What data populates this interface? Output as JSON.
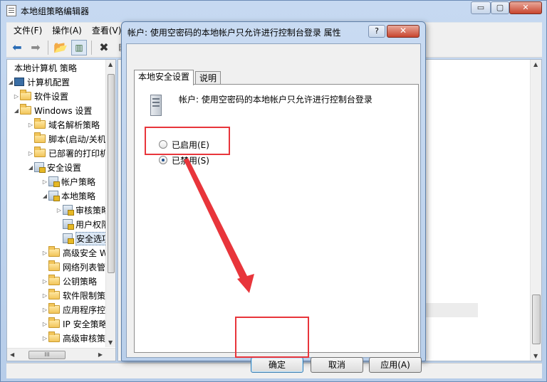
{
  "main_window": {
    "title": "本地组策略编辑器",
    "controls": {
      "minimize": "▭",
      "restore": "▢",
      "close": "✕"
    },
    "menu": [
      "文件(F)",
      "操作(A)",
      "查看(V)"
    ],
    "toolbar_icons": [
      "back-arrow-icon",
      "forward-arrow-icon",
      "up-folder-icon",
      "show-hide-tree-icon",
      "delete-icon",
      "properties-icon"
    ]
  },
  "tree": [
    {
      "label": "本地计算机 策略",
      "icon": "policy-icon",
      "arrow": ""
    },
    {
      "label": "计算机配置",
      "icon": "computer-icon",
      "arrow": "◢"
    },
    {
      "label": "软件设置",
      "icon": "folder-icon",
      "arrow": "▷"
    },
    {
      "label": "Windows 设置",
      "icon": "folder-icon",
      "arrow": "◢"
    },
    {
      "label": "域名解析策略",
      "icon": "folder-icon",
      "arrow": "▷"
    },
    {
      "label": "脚本(启动/关机",
      "icon": "script-icon",
      "arrow": ""
    },
    {
      "label": "已部署的打印机",
      "icon": "printer-icon",
      "arrow": "▷"
    },
    {
      "label": "安全设置",
      "icon": "security-icon",
      "arrow": "◢"
    },
    {
      "label": "帐户策略",
      "icon": "folder-lock-icon",
      "arrow": "▷"
    },
    {
      "label": "本地策略",
      "icon": "folder-lock-icon",
      "arrow": "◢"
    },
    {
      "label": "审核策略",
      "icon": "folder-lock-icon",
      "arrow": "▷"
    },
    {
      "label": "用户权限",
      "icon": "folder-lock-icon",
      "arrow": ""
    },
    {
      "label": "安全选项",
      "icon": "folder-lock-icon",
      "arrow": ""
    },
    {
      "label": "高级安全 W",
      "icon": "folder-icon",
      "arrow": "▷"
    },
    {
      "label": "网络列表管理",
      "icon": "folder-icon",
      "arrow": ""
    },
    {
      "label": "公钥策略",
      "icon": "folder-icon",
      "arrow": "▷"
    },
    {
      "label": "软件限制策略",
      "icon": "folder-icon",
      "arrow": "▷"
    },
    {
      "label": "应用程序控制",
      "icon": "folder-icon",
      "arrow": "▷"
    },
    {
      "label": "IP 安全策略",
      "icon": "ip-security-icon",
      "arrow": "▷"
    },
    {
      "label": "高级审核策略",
      "icon": "folder-icon",
      "arrow": "▷"
    }
  ],
  "scrollbar_h_grip": "III",
  "dialog": {
    "title": "帐户: 使用空密码的本地帐户只允许进行控制台登录 属性",
    "help": "?",
    "close": "✕",
    "tabs": [
      "本地安全设置",
      "说明"
    ],
    "policy_name": "帐户: 使用空密码的本地帐户只允许进行控制台登录",
    "options": [
      {
        "label": "已启用(E)",
        "checked": false
      },
      {
        "label": "已禁用(S)",
        "checked": true
      }
    ],
    "buttons": {
      "ok": "确定",
      "cancel": "取消",
      "apply": "应用(A)"
    }
  },
  "annotations": {
    "highlight_color": "#e8353b"
  }
}
